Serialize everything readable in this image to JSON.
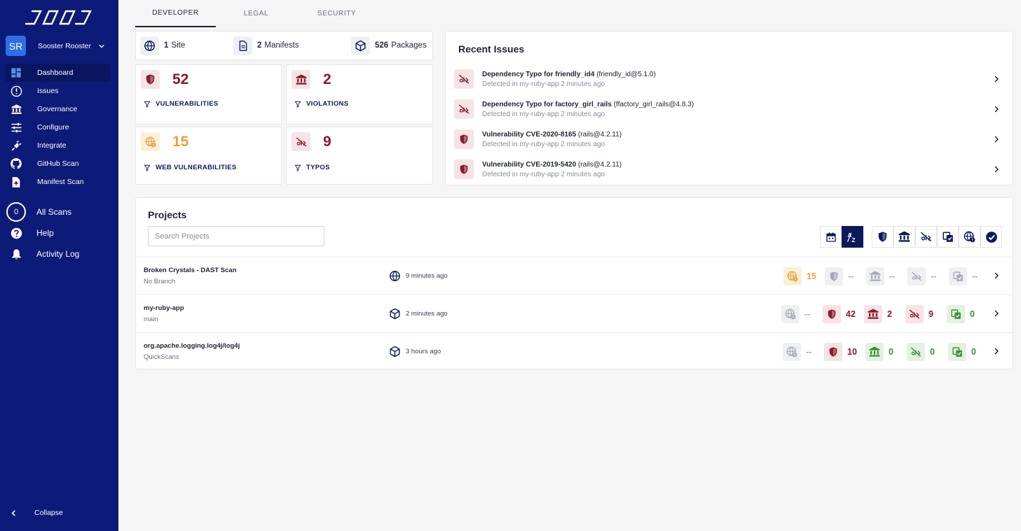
{
  "colors": {
    "sidebar": "#0c1a78",
    "danger": "#8b1a2b",
    "warning": "#e8a23c",
    "success": "#3f8f3a",
    "muted": "#a7aab6"
  },
  "user": {
    "initials": "SR",
    "name": "Sooster Rooster"
  },
  "nav": [
    {
      "label": "Dashboard",
      "icon": "dashboard-icon"
    },
    {
      "label": "Issues",
      "icon": "alert-circle-icon"
    },
    {
      "label": "Governance",
      "icon": "bank-icon"
    },
    {
      "label": "Configure",
      "icon": "sliders-icon"
    },
    {
      "label": "Integrate",
      "icon": "plug-icon"
    },
    {
      "label": "GitHub Scan",
      "icon": "github-icon"
    },
    {
      "label": "Manifest Scan",
      "icon": "file-plus-icon"
    }
  ],
  "nav2": {
    "all_scans_count": "0",
    "all_scans": "All Scans",
    "help": "Help",
    "activity_log": "Activity Log"
  },
  "collapse": "Collapse",
  "tabs": [
    "DEVELOPER",
    "LEGAL",
    "SECURITY"
  ],
  "summary": {
    "sites_count": "1",
    "sites_label": "Site",
    "manifests_count": "2",
    "manifests_label": "Manifests",
    "packages_count": "526",
    "packages_label": "Packages"
  },
  "cards": {
    "vulnerabilities": {
      "value": "52",
      "label": "VULNERABILITIES"
    },
    "violations": {
      "value": "2",
      "label": "VIOLATIONS"
    },
    "web_vulnerabilities": {
      "value": "15",
      "label": "WEB VULNERABILITIES"
    },
    "typos": {
      "value": "9",
      "label": "TYPOS"
    }
  },
  "recent": {
    "title": "Recent Issues",
    "items": [
      {
        "title": "Dependency Typo for friendly_id4",
        "pkg": "(friendly_id@5.1.0)",
        "sub": "Detected in my-ruby-app 2 minutes ago",
        "icon": "typo-icon"
      },
      {
        "title": "Dependency Typo for factory_girl_rails",
        "pkg": "(ffactory_girl_rails@4.8.3)",
        "sub": "Detected in my-ruby-app 2 minutes ago",
        "icon": "typo-icon"
      },
      {
        "title": "Vulnerability CVE-2020-8165",
        "pkg": "(rails@4.2.11)",
        "sub": "Detected in my-ruby-app 2 minutes ago",
        "icon": "shield-icon"
      },
      {
        "title": "Vulnerability CVE-2019-5420",
        "pkg": "(rails@4.2.11)",
        "sub": "Detected in my-ruby-app 2 minutes ago",
        "icon": "shield-icon"
      }
    ]
  },
  "projects": {
    "title": "Projects",
    "search_placeholder": "Search Projects",
    "rows": [
      {
        "name": "Broken Crystals - DAST Scan",
        "branch": "No Branch",
        "time": "9 minutes ago",
        "time_icon": "globe-icon",
        "web": "15",
        "vuln": "--",
        "viol": "--",
        "typo": "--",
        "dep": "--"
      },
      {
        "name": "my-ruby-app",
        "branch": "main",
        "time": "2 minutes ago",
        "time_icon": "package-icon",
        "web": "--",
        "vuln": "42",
        "viol": "2",
        "typo": "9",
        "dep": "0"
      },
      {
        "name": "org.apache.logging.log4j/log4j",
        "branch": "QuickScans",
        "time": "3 hours ago",
        "time_icon": "package-icon",
        "web": "--",
        "vuln": "10",
        "viol": "0",
        "typo": "0",
        "dep": "0"
      }
    ]
  }
}
